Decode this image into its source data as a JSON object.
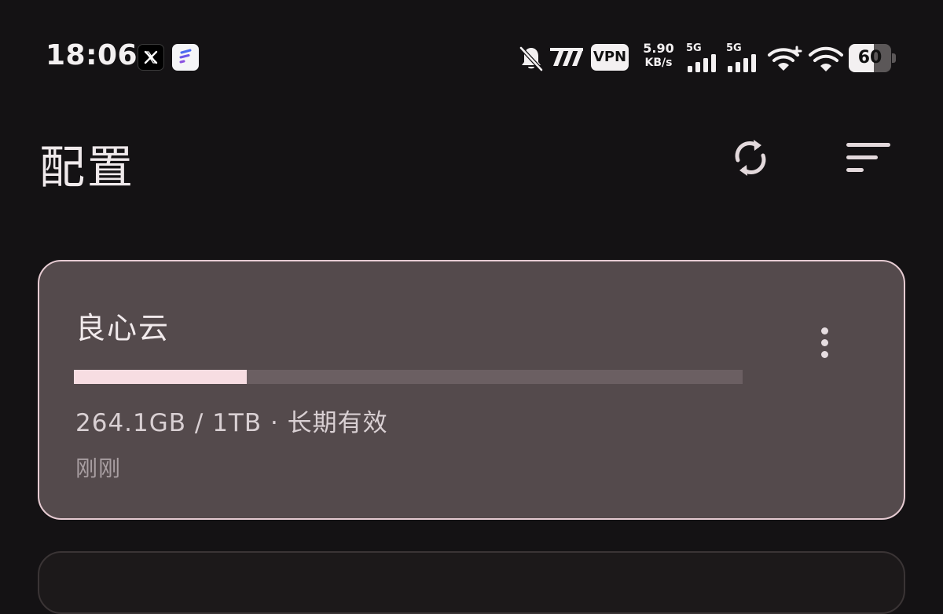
{
  "status_bar": {
    "time": "18:06",
    "apps": [
      {
        "name": "x-app-icon",
        "glyph": "𝕏"
      },
      {
        "name": "f-app-icon",
        "glyph": "f"
      }
    ],
    "vpn_label": "VPN",
    "speed_value": "5.90",
    "speed_unit": "KB/s",
    "sim1_label": "5G",
    "sim2_label": "5G",
    "battery_level": "60",
    "battery_percent": 60
  },
  "header": {
    "title": "配置"
  },
  "profile": {
    "name": "良心云",
    "usage": "264.1GB / 1TB · 长期有效",
    "used": "264.1GB",
    "total": "1TB",
    "usage_fraction": 0.258,
    "validity": "长期有效",
    "updated": "刚刚"
  },
  "colors": {
    "background": "#141214",
    "card": "#544a4c",
    "card_border": "#e6cbd2",
    "progress_fill": "#f7dde2",
    "progress_track": "#6b5f62"
  },
  "icons": {
    "refresh": "sync-icon",
    "sort": "sort-icon",
    "more": "more-vert-icon",
    "mute": "bell-off-icon",
    "wifi": "wifi-icon"
  }
}
